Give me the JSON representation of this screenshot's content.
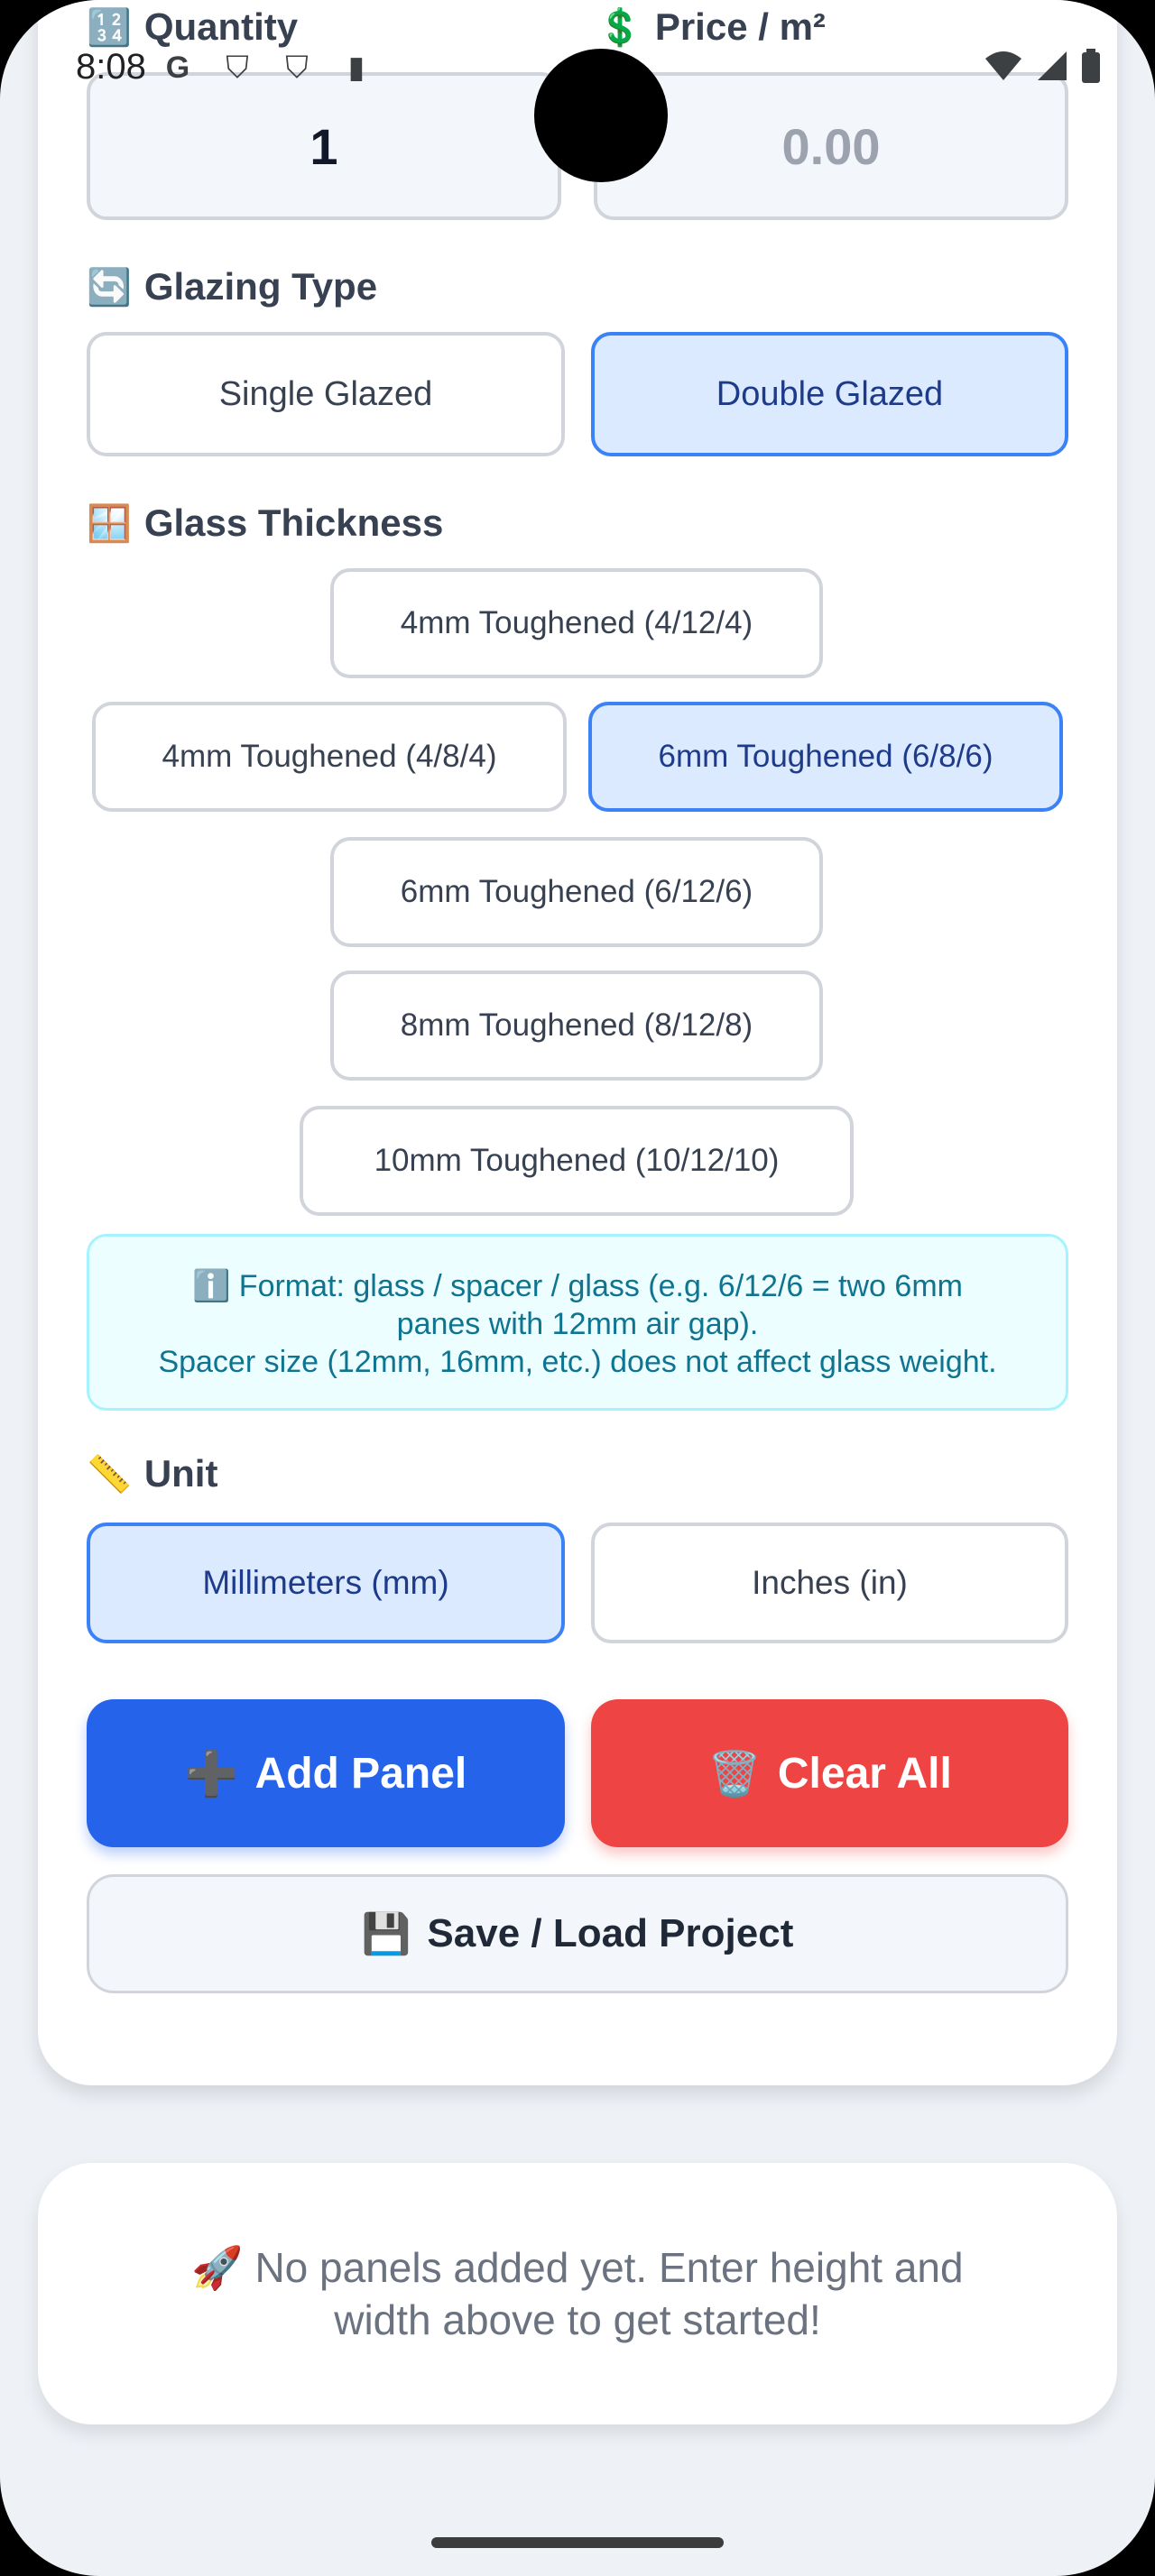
{
  "status_bar": {
    "time": "8:08"
  },
  "form": {
    "quantity_label": "Quantity",
    "quantity_emoji": "🔢",
    "price_label": "Price / m²",
    "price_emoji": "💲",
    "quantity_value": "1",
    "price_placeholder": "0.00",
    "glazing_label": "Glazing Type",
    "glazing_emoji": "🔄",
    "glazing_options": [
      "Single Glazed",
      "Double Glazed"
    ],
    "glazing_selected": "Double Glazed",
    "thickness_label": "Glass Thickness",
    "thickness_emoji": "🪟",
    "thickness_options": [
      "4mm Toughened (4/12/4)",
      "4mm Toughened (4/8/4)",
      "6mm Toughened (6/8/6)",
      "6mm Toughened (6/12/6)",
      "8mm Toughened (8/12/8)",
      "10mm Toughened (10/12/10)"
    ],
    "thickness_selected": "6mm Toughened (6/8/6)",
    "info_line1": "ℹ️ Format: glass / spacer / glass (e.g. 6/12/6 = two 6mm panes with 12mm air gap).",
    "info_line2": "Spacer size (12mm, 16mm, etc.) does not affect glass weight.",
    "unit_label": "Unit",
    "unit_emoji": "📏",
    "unit_options": [
      "Millimeters (mm)",
      "Inches (in)"
    ],
    "unit_selected": "Millimeters (mm)",
    "add_panel_label": "Add Panel",
    "add_panel_emoji": "➕",
    "clear_all_label": "Clear All",
    "clear_all_emoji": "🗑️",
    "save_load_label": "Save / Load Project",
    "save_load_emoji": "💾"
  },
  "panels": {
    "empty_message": "🚀 No panels added yet. Enter height and width above to get started!"
  }
}
